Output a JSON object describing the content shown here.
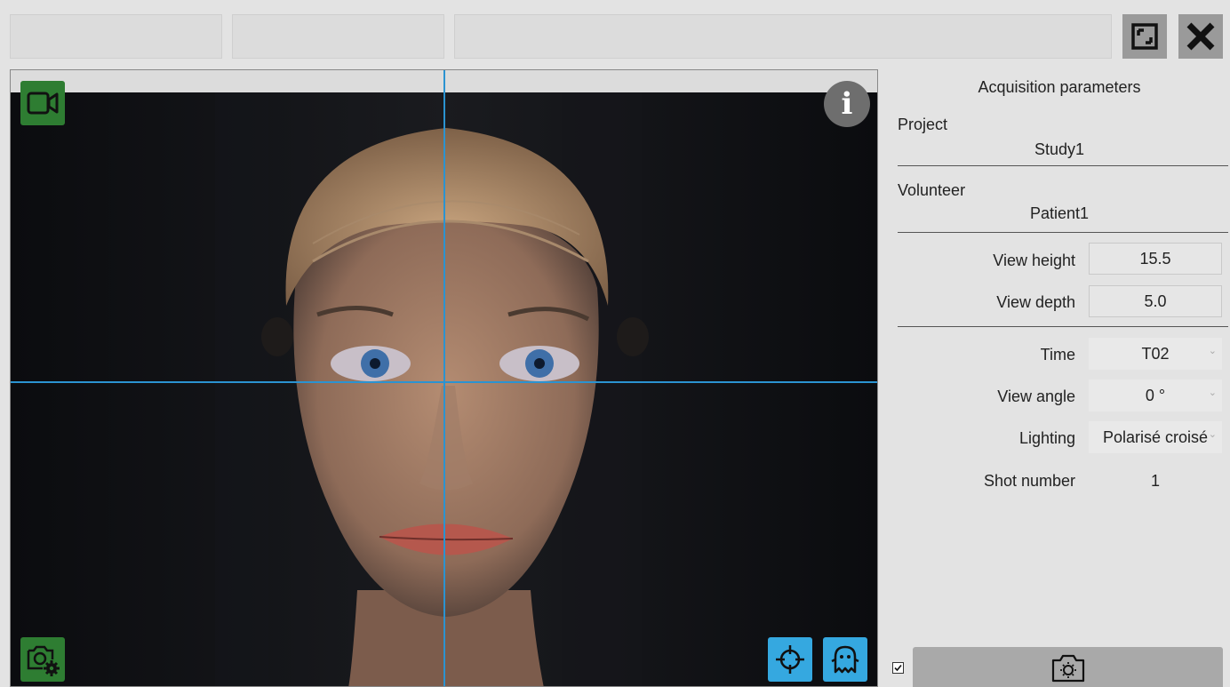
{
  "panel": {
    "title": "Acquisition parameters",
    "project_label": "Project",
    "project_value": "Study1",
    "volunteer_label": "Volunteer",
    "volunteer_value": "Patient1",
    "view_height_label": "View height",
    "view_height_value": "15.5",
    "view_depth_label": "View depth",
    "view_depth_value": "5.0",
    "time_label": "Time",
    "time_value": "T02",
    "view_angle_label": "View angle",
    "view_angle_value": "0 °",
    "lighting_label": "Lighting",
    "lighting_value": "Polarisé croisé",
    "shot_number_label": "Shot number",
    "shot_number_value": "1"
  },
  "info_glyph": "i",
  "icons": {
    "video": "video-camera-icon",
    "camera_settings": "camera-settings-icon",
    "crosshair": "crosshair-icon",
    "ghost": "ghost-icon",
    "info": "info-icon",
    "restore": "restore-window-icon",
    "close": "close-icon",
    "capture": "camera-capture-icon"
  },
  "colors": {
    "accent_green": "#2e7d32",
    "accent_blue": "#35a8e0",
    "guide_line": "#2b93d1",
    "capture_button": "#a9a9a9"
  }
}
